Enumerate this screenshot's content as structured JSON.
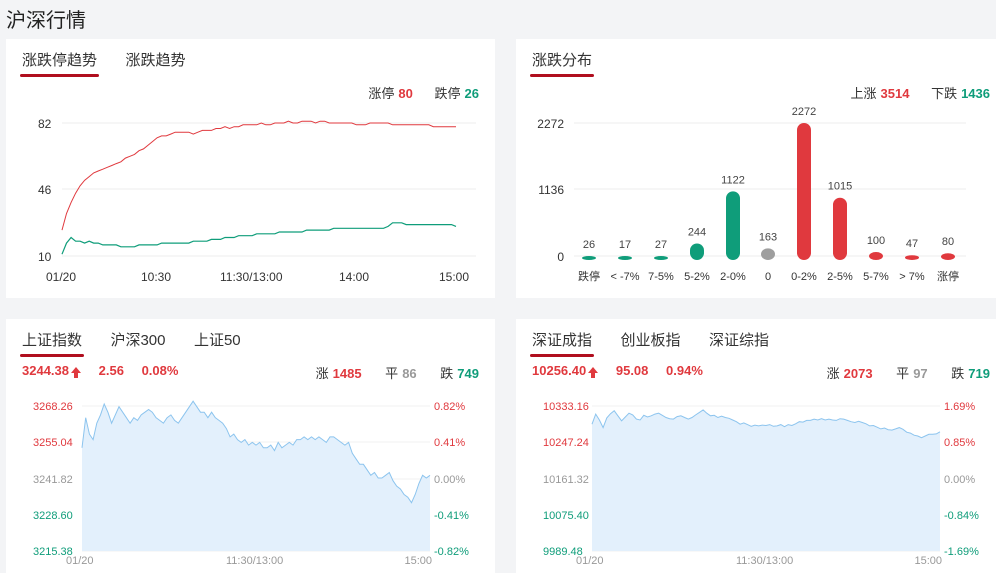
{
  "page_title": "沪深行情",
  "limit_card": {
    "tabs": [
      "涨跌停趋势",
      "涨跌趋势"
    ],
    "stats": {
      "up_label": "涨停",
      "up_value": "80",
      "down_label": "跌停",
      "down_value": "26"
    },
    "y_ticks": [
      "82",
      "46",
      "10"
    ],
    "x_ticks": [
      "01/20",
      "10:30",
      "11:30/13:00",
      "14:00",
      "15:00"
    ]
  },
  "dist_card": {
    "tabs": [
      "涨跌分布"
    ],
    "stats": {
      "up_label": "上涨",
      "up_value": "3514",
      "down_label": "下跌",
      "down_value": "1436"
    },
    "y_ticks": [
      "2272",
      "1136",
      "0"
    ]
  },
  "sh_card": {
    "tabs": [
      "上证指数",
      "沪深300",
      "上证50"
    ],
    "price": "3244.38",
    "change": "2.56",
    "pct": "0.08%",
    "rise_label": "涨",
    "rise": "1485",
    "flat_label": "平",
    "flat": "86",
    "fall_label": "跌",
    "fall": "749",
    "y_left": [
      "3268.26",
      "3255.04",
      "3241.82",
      "3228.60",
      "3215.38"
    ],
    "y_right": [
      "0.82%",
      "0.41%",
      "0.00%",
      "-0.41%",
      "-0.82%"
    ],
    "x_ticks": [
      "01/20",
      "11:30/13:00",
      "15:00"
    ]
  },
  "sz_card": {
    "tabs": [
      "深证成指",
      "创业板指",
      "深证综指"
    ],
    "price": "10256.40",
    "change": "95.08",
    "pct": "0.94%",
    "rise_label": "涨",
    "rise": "2073",
    "flat_label": "平",
    "flat": "97",
    "fall_label": "跌",
    "fall": "719",
    "y_left": [
      "10333.16",
      "10247.24",
      "10161.32",
      "10075.40",
      "9989.48"
    ],
    "y_right": [
      "1.69%",
      "0.85%",
      "0.00%",
      "-0.84%",
      "-1.69%"
    ],
    "x_ticks": [
      "01/20",
      "11:30/13:00",
      "15:00"
    ]
  },
  "colors": {
    "red": "#e0393e",
    "green": "#0f9d7a",
    "gray": "#9e9e9e",
    "line": "#8cc4ee",
    "fill": "#e3f0fc"
  },
  "chart_data": [
    {
      "type": "line",
      "x_ticks": [
        "01/20",
        "10:30",
        "11:30/13:00",
        "14:00",
        "15:00"
      ],
      "ylim": [
        10,
        82
      ],
      "series": [
        {
          "name": "涨停",
          "values": [
            24,
            33,
            39,
            44,
            48,
            51,
            53,
            55,
            56,
            57,
            58,
            59,
            60,
            61,
            63,
            64,
            65,
            67,
            68,
            70,
            72,
            74,
            75,
            75,
            76,
            77,
            77,
            77,
            77,
            76,
            77,
            78,
            78,
            78,
            79,
            79,
            80,
            79,
            80,
            80,
            81,
            81,
            81,
            81,
            82,
            81,
            81,
            82,
            82,
            82,
            83,
            82,
            82,
            83,
            83,
            83,
            82,
            83,
            83,
            82,
            82,
            82,
            82,
            82,
            82,
            81,
            81,
            81,
            82,
            82,
            82,
            82,
            82,
            81,
            81,
            81,
            81,
            81,
            81,
            81,
            81,
            81,
            80,
            80,
            80,
            80,
            80,
            80
          ]
        },
        {
          "name": "跌停",
          "values": [
            11,
            17,
            20,
            18,
            18,
            17,
            18,
            17,
            17,
            16,
            16,
            16,
            16,
            15,
            15,
            15,
            15,
            16,
            16,
            16,
            16,
            16,
            17,
            17,
            17,
            17,
            17,
            17,
            17,
            18,
            18,
            18,
            18,
            19,
            19,
            19,
            20,
            20,
            20,
            21,
            21,
            21,
            21,
            22,
            22,
            22,
            22,
            22,
            23,
            23,
            23,
            23,
            23,
            23,
            24,
            24,
            24,
            24,
            24,
            24,
            25,
            25,
            25,
            25,
            25,
            25,
            25,
            25,
            25,
            25,
            25,
            25,
            26,
            28,
            28,
            28,
            27,
            27,
            27,
            27,
            27,
            27,
            27,
            27,
            27,
            27,
            27,
            26
          ]
        }
      ]
    },
    {
      "type": "bar",
      "categories": [
        "跌停",
        "< -7%",
        "7-5%",
        "5-2%",
        "2-0%",
        "0",
        "0-2%",
        "2-5%",
        "5-7%",
        "> 7%",
        "涨停"
      ],
      "values": [
        26,
        17,
        27,
        244,
        1122,
        163,
        2272,
        1015,
        100,
        47,
        80
      ],
      "ylim": [
        0,
        2272
      ]
    },
    {
      "type": "area",
      "ylim": [
        3215.38,
        3268.26
      ],
      "x_ticks": [
        "01/20",
        "11:30/13:00",
        "15:00"
      ],
      "values": [
        3253,
        3264,
        3258,
        3256,
        3262,
        3265,
        3269,
        3266,
        3262,
        3265,
        3268,
        3266,
        3264,
        3262,
        3264,
        3263,
        3265,
        3266,
        3267,
        3266,
        3264,
        3263,
        3262,
        3264,
        3265,
        3263,
        3262,
        3264,
        3266,
        3268,
        3270,
        3268,
        3266,
        3266,
        3264,
        3266,
        3264,
        3263,
        3262,
        3260,
        3257,
        3258,
        3256,
        3255,
        3256,
        3254,
        3255,
        3254,
        3255,
        3253,
        3253,
        3254,
        3252,
        3255,
        3253,
        3254,
        3255,
        3254,
        3256,
        3256,
        3257,
        3256,
        3257,
        3256,
        3257,
        3256,
        3255,
        3257,
        3257,
        3256,
        3255,
        3254,
        3255,
        3251,
        3249,
        3247,
        3247,
        3245,
        3243,
        3244,
        3242,
        3242,
        3243,
        3244,
        3241,
        3239,
        3238,
        3236,
        3235,
        3233,
        3236,
        3240,
        3243,
        3242,
        3243
      ],
      "x_range_note": "values span full session"
    },
    {
      "type": "area",
      "ylim": [
        9989.48,
        10333.16
      ],
      "x_ticks": [
        "01/20",
        "11:30/13:00",
        "15:00"
      ],
      "values": [
        10290,
        10314,
        10300,
        10282,
        10305,
        10315,
        10322,
        10310,
        10298,
        10307,
        10316,
        10312,
        10302,
        10300,
        10311,
        10307,
        10310,
        10314,
        10316,
        10311,
        10306,
        10303,
        10302,
        10308,
        10310,
        10306,
        10302,
        10306,
        10312,
        10318,
        10324,
        10316,
        10310,
        10311,
        10306,
        10309,
        10306,
        10304,
        10300,
        10296,
        10290,
        10293,
        10289,
        10285,
        10288,
        10286,
        10288,
        10287,
        10289,
        10285,
        10286,
        10289,
        10284,
        10289,
        10287,
        10291,
        10296,
        10295,
        10299,
        10299,
        10302,
        10300,
        10303,
        10300,
        10302,
        10300,
        10299,
        10303,
        10302,
        10299,
        10296,
        10294,
        10297,
        10294,
        10291,
        10286,
        10287,
        10283,
        10279,
        10281,
        10277,
        10276,
        10279,
        10282,
        10278,
        10271,
        10269,
        10264,
        10262,
        10258,
        10262,
        10266,
        10266,
        10267,
        10272
      ]
    }
  ]
}
